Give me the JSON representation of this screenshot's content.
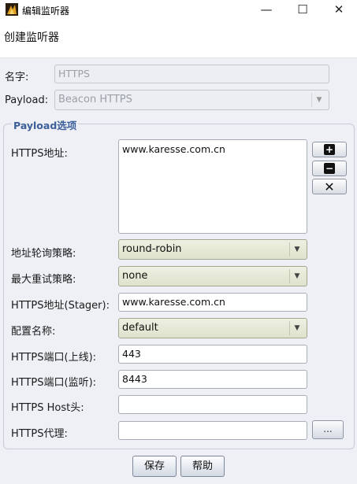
{
  "window": {
    "title": "编辑监听器",
    "controls": {
      "minimize": "—",
      "maximize": "☐",
      "close": "✕"
    }
  },
  "header": {
    "text": "创建监听器"
  },
  "name": {
    "label": "名字:",
    "value": "HTTPS"
  },
  "payload": {
    "label": "Payload:",
    "value": "Beacon HTTPS"
  },
  "options_group": {
    "title": "Payload选项"
  },
  "https_hosts": {
    "label": "HTTPS地址:",
    "value": "www.karesse.com.cn"
  },
  "side_buttons": {
    "add": "+",
    "remove": "−",
    "clear": "✕"
  },
  "rotation_strategy": {
    "label": "地址轮询策略:",
    "value": "round-robin"
  },
  "max_retry": {
    "label": "最大重试策略:",
    "value": "none"
  },
  "stager_host": {
    "label": "HTTPS地址(Stager):",
    "value": "www.karesse.com.cn"
  },
  "profile": {
    "label": "配置名称:",
    "value": "default"
  },
  "port_c2": {
    "label": "HTTPS端口(上线):",
    "value": "443"
  },
  "port_bind": {
    "label": "HTTPS端口(监听):",
    "value": "8443"
  },
  "host_header": {
    "label": "HTTPS Host头:",
    "value": ""
  },
  "proxy": {
    "label": "HTTPS代理:",
    "value": "",
    "button": "..."
  },
  "buttons": {
    "save": "保存",
    "help": "帮助"
  },
  "icons": {
    "combo_arrow": "▼",
    "app_icon": "cobalt-strike-icon"
  }
}
